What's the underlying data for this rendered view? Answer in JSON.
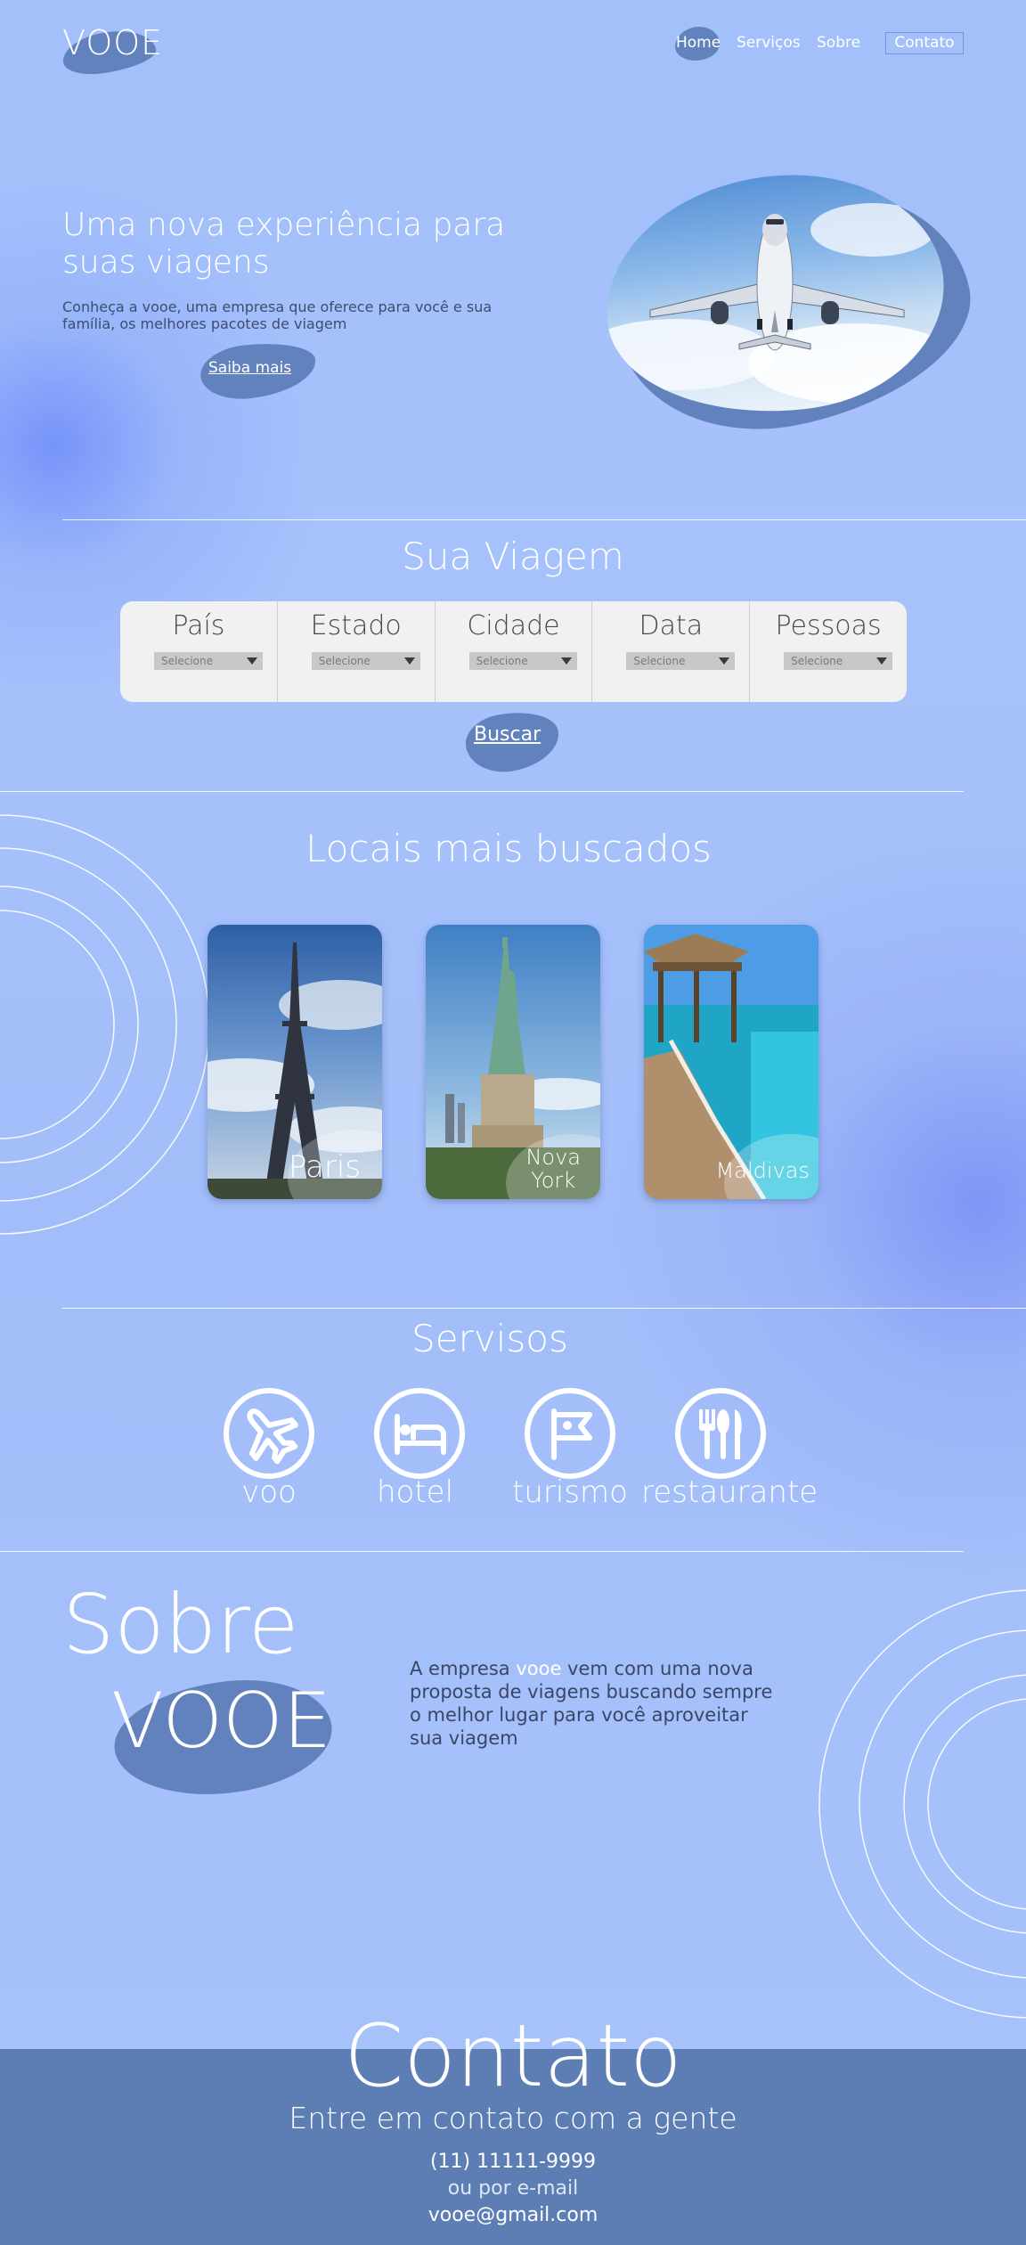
{
  "nav": {
    "logo": "VOOE",
    "links": [
      {
        "label": "Home"
      },
      {
        "label": "Serviços"
      },
      {
        "label": "Sobre"
      },
      {
        "label": "Contato"
      }
    ]
  },
  "hero": {
    "title": "Uma nova experiência para suas viagens",
    "subtitle": "Conheça a vooe, uma empresa que oferece para você e sua família, os melhores pacotes de viagem",
    "cta": "Saiba mais"
  },
  "search": {
    "title": "Sua Viagem",
    "fields": [
      {
        "label": "País",
        "placeholder": "Selecione"
      },
      {
        "label": "Estado",
        "placeholder": "Selecione"
      },
      {
        "label": "Cidade",
        "placeholder": "Selecione"
      },
      {
        "label": "Data",
        "placeholder": "Selecione"
      },
      {
        "label": "Pessoas",
        "placeholder": "Selecione"
      }
    ],
    "button": "Buscar"
  },
  "locais": {
    "title": "Locais mais buscados",
    "cards": [
      {
        "label": "Paris",
        "icon": "eiffel-tower-photo"
      },
      {
        "label": "Nova York",
        "line1": "Nova",
        "line2": "York",
        "icon": "statue-of-liberty-photo"
      },
      {
        "label": "Maldivas",
        "icon": "maldives-pier-photo"
      }
    ]
  },
  "services": {
    "title": "Servisos",
    "items": [
      {
        "label": "voo",
        "icon": "airplane-icon"
      },
      {
        "label": "hotel",
        "icon": "bed-icon"
      },
      {
        "label": "turismo",
        "icon": "flag-icon"
      },
      {
        "label": "restaurante",
        "icon": "cutlery-icon"
      }
    ]
  },
  "sobre": {
    "title": "Sobre",
    "brand": "VOOE",
    "text_before": "A empresa ",
    "text_highlight": "vooe",
    "text_after": " vem com uma nova proposta de viagens buscando sempre o melhor lugar para você aproveitar sua viagem"
  },
  "contato": {
    "title": "Contato",
    "subtitle": "Entre em contato com a gente",
    "phone": "(11) 11111-9999",
    "or": "ou por e-mail",
    "email": "vooe@gmail.com"
  },
  "colors": {
    "accent_blob": "#6282be",
    "footer": "#5d7db5",
    "background": "#a3c0fb"
  }
}
